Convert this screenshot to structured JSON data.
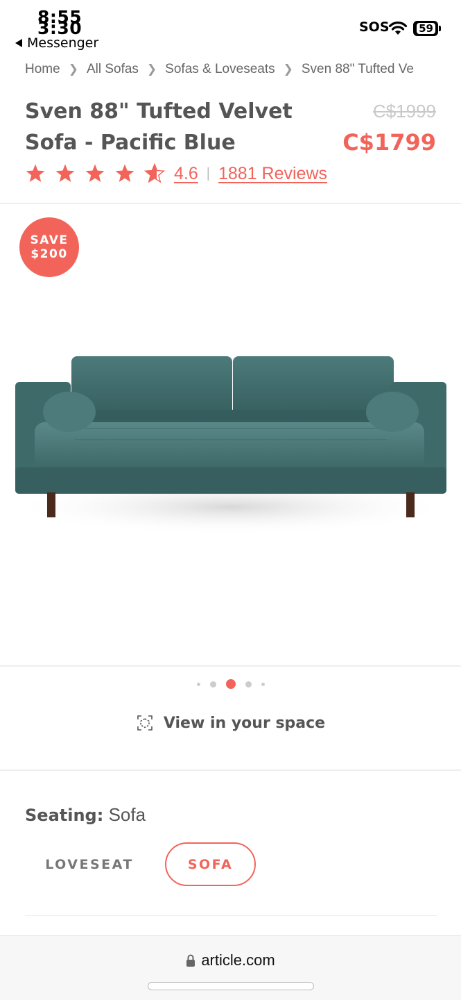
{
  "status_bar": {
    "time_primary": "8:55",
    "time_overlay": "3:30",
    "back_app": "Messenger",
    "sos": "SOS",
    "battery": "59"
  },
  "breadcrumb": [
    "Home",
    "All Sofas",
    "Sofas & Loveseats",
    "Sven 88\" Tufted Ve"
  ],
  "product": {
    "title": "Sven 88\" Tufted Velvet Sofa - Pacific Blue",
    "price_original": "C$1999",
    "price_sale": "C$1799",
    "rating_value": "4.6",
    "rating_stars": 4.6,
    "review_count": "1881 Reviews",
    "save_badge": {
      "line1": "SAVE",
      "line2": "$200"
    }
  },
  "carousel": {
    "dot_count": 5,
    "active_index": 2
  },
  "view_in_space": "View in your space",
  "seating": {
    "label": "Seating:",
    "value": "Sofa",
    "options": [
      {
        "label": "LOVESEAT",
        "selected": false
      },
      {
        "label": "SOFA",
        "selected": true
      }
    ]
  },
  "browser": {
    "url": "article.com"
  },
  "colors": {
    "accent": "#f2645a",
    "text": "#555555",
    "sofa": "#3f6b6b",
    "leg": "#4a2a1c"
  }
}
